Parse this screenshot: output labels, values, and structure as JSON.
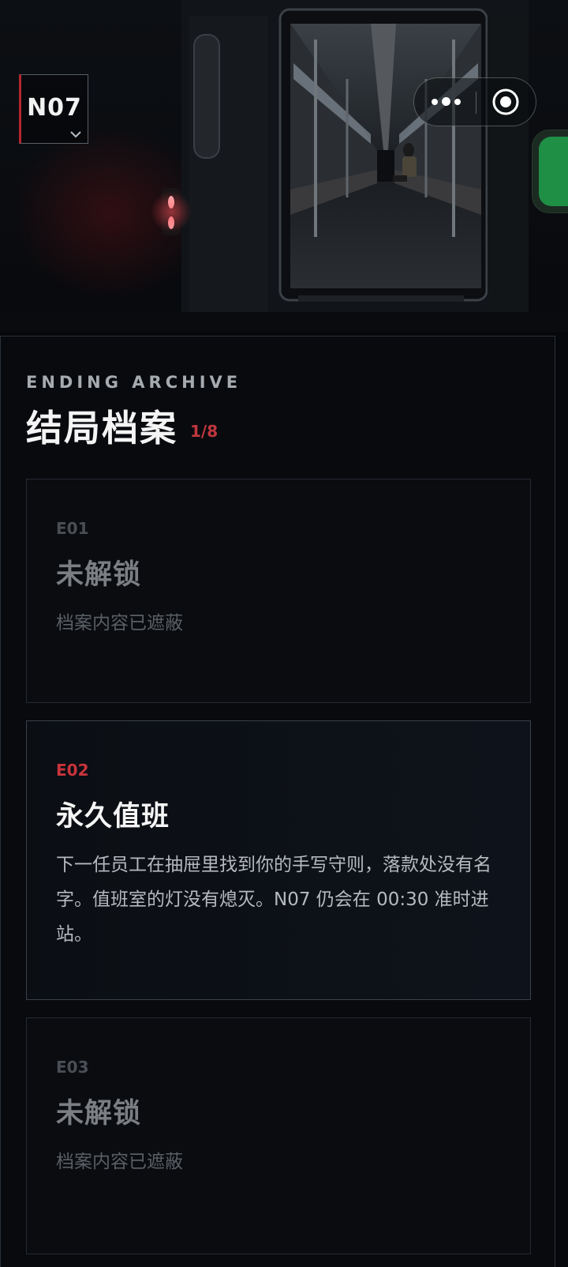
{
  "line_badge": {
    "label": "N07",
    "chevron_icon": "chevron-down-icon"
  },
  "capsule": {
    "more_icon": "more-dots-icon",
    "close_icon": "target-close-icon"
  },
  "hero": {
    "scene": "subway-car-corridor-image"
  },
  "archive": {
    "kicker": "ENDING ARCHIVE",
    "title": "结局档案",
    "count": "1/8",
    "endings": [
      {
        "code": "E01",
        "title": "未解锁",
        "description": "档案内容已遮蔽",
        "unlocked": false
      },
      {
        "code": "E02",
        "title": "永久值班",
        "description": "下一任员工在抽屉里找到你的手写守则，落款处没有名字。值班室的灯没有熄灭。N07 仍会在 00:30 准时进站。",
        "unlocked": true
      },
      {
        "code": "E03",
        "title": "未解锁",
        "description": "档案内容已遮蔽",
        "unlocked": false
      }
    ]
  },
  "colors": {
    "accent_red": "#c9343c",
    "background": "#07090c",
    "locked_text": "#7b7f84"
  }
}
